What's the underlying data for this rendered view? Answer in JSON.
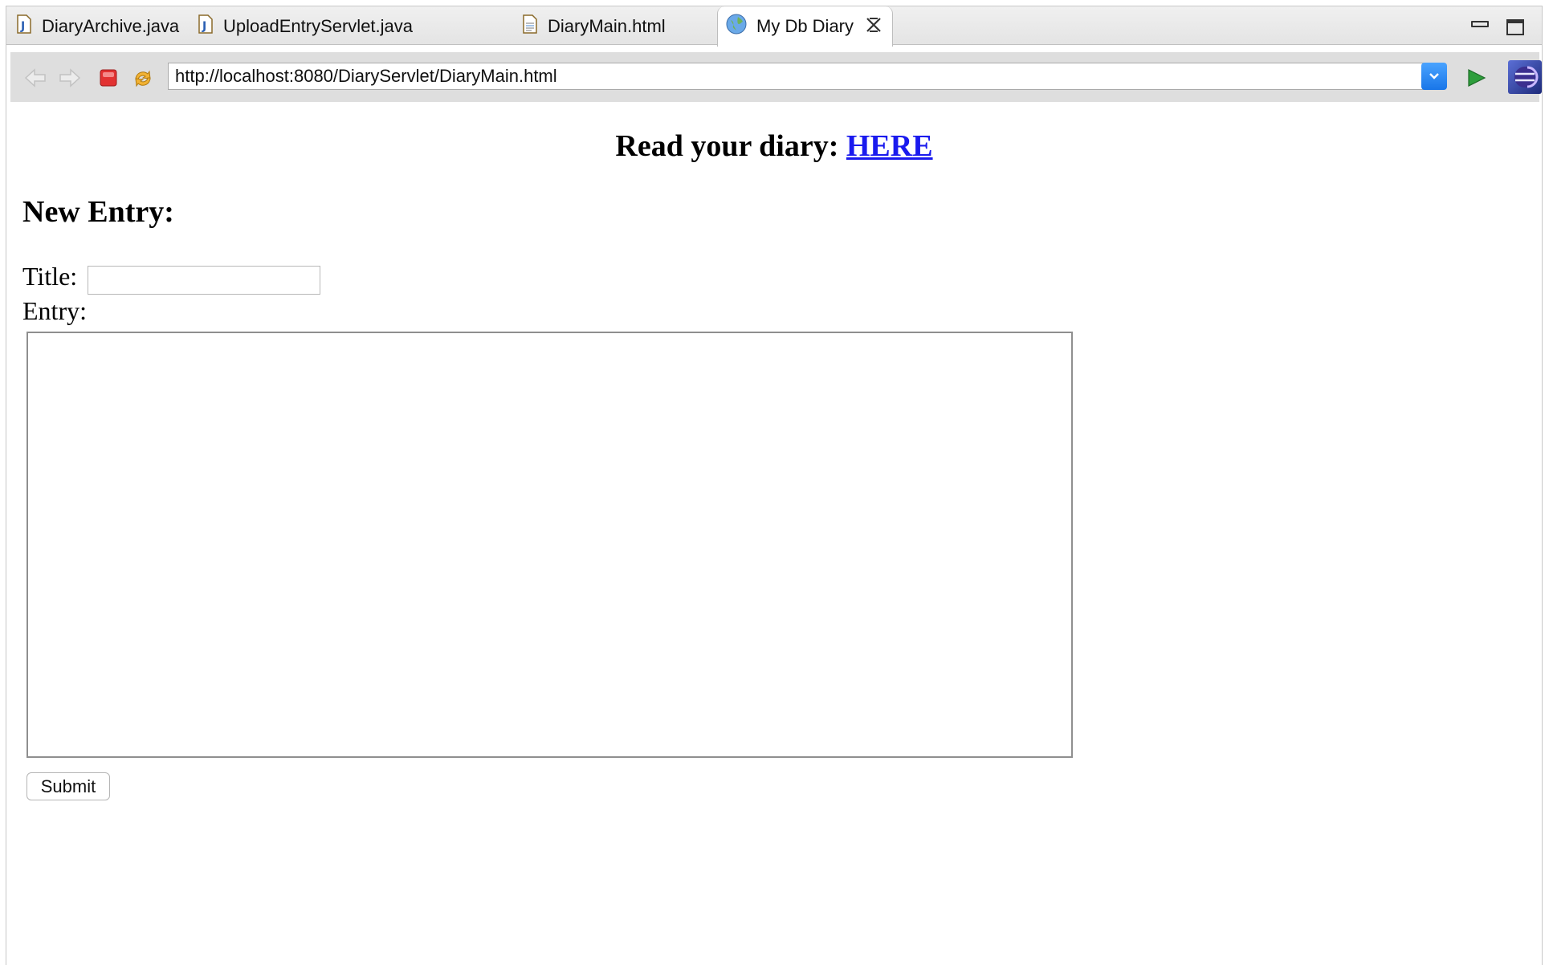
{
  "tabs": [
    {
      "label": "DiaryArchive.java",
      "icon": "java-file-icon"
    },
    {
      "label": "UploadEntryServlet.java",
      "icon": "java-file-icon"
    },
    {
      "label": "DiaryMain.html",
      "icon": "html-file-icon"
    },
    {
      "label": "My Db Diary",
      "icon": "globe-icon",
      "active": true
    }
  ],
  "toolbar": {
    "url": "http://localhost:8080/DiaryServlet/DiaryMain.html"
  },
  "page": {
    "read_prefix": "Read your diary:",
    "read_link": "HERE",
    "heading": "New Entry:",
    "title_label": "Title:",
    "title_value": "",
    "entry_label": "Entry:",
    "entry_value": "",
    "submit_label": "Submit"
  },
  "colors": {
    "link": "#1a1aee",
    "stop": "#e23232",
    "go": "#2e9e3c",
    "dropdown": "#1976e8"
  }
}
